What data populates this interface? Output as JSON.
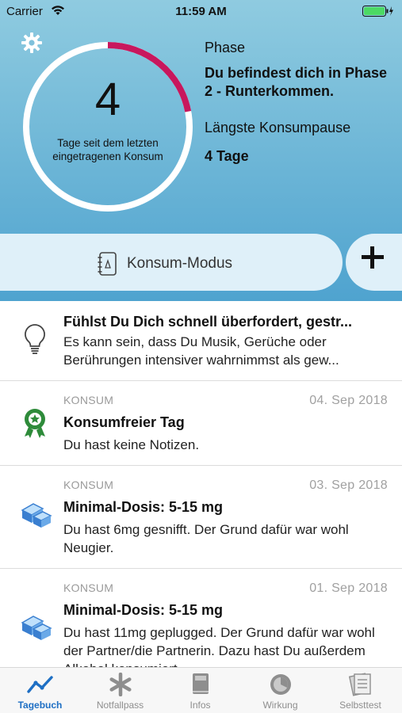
{
  "status_bar": {
    "carrier": "Carrier",
    "time": "11:59 AM"
  },
  "summary": {
    "days_count": "4",
    "days_caption": "Tage seit dem letzten eingetragenen Konsum",
    "progress_fraction": 0.22,
    "phase_label": "Phase",
    "phase_value": "Du befindest dich in Phase 2 - Runterkommen.",
    "pause_label": "Längste Konsumpause",
    "pause_value": "4 Tage"
  },
  "mode": {
    "label": "Konsum-Modus"
  },
  "feed": {
    "tip": {
      "title": "Fühlst Du Dich schnell überfordert, gestr...",
      "body": "Es kann sein, dass Du Musik, Gerüche oder Berührungen intensiver wahrnimmst als gew..."
    },
    "entries": [
      {
        "category": "KONSUM",
        "date": "04. Sep 2018",
        "title": "Konsumfreier Tag",
        "body": "Du hast keine Notizen.",
        "icon": "award-badge-icon"
      },
      {
        "category": "KONSUM",
        "date": "03. Sep 2018",
        "title": "Minimal-Dosis: 5-15 mg",
        "body": "Du hast 6mg gesnifft. Der Grund dafür war wohl Neugier.",
        "icon": "blocks-icon"
      },
      {
        "category": "KONSUM",
        "date": "01. Sep 2018",
        "title": "Minimal-Dosis: 5-15 mg",
        "body": "Du hast 11mg geplugged. Der Grund dafür war wohl der Partner/die Partnerin. Dazu hast Du außerdem Alkohol konsumiert.",
        "icon": "blocks-icon"
      }
    ]
  },
  "tabs": [
    {
      "label": "Tagebuch",
      "icon": "chart-line-icon",
      "active": true
    },
    {
      "label": "Notfallpass",
      "icon": "asterisk-icon",
      "active": false
    },
    {
      "label": "Infos",
      "icon": "book-icon",
      "active": false
    },
    {
      "label": "Wirkung",
      "icon": "gauge-icon",
      "active": false
    },
    {
      "label": "Selbsttest",
      "icon": "checklist-icon",
      "active": false
    }
  ],
  "colors": {
    "accent": "#1e6fc4",
    "ring_progress": "#c8175d",
    "ring_track": "#ffffff",
    "award": "#2e8b3a",
    "blocks": "#3a7fd0"
  }
}
